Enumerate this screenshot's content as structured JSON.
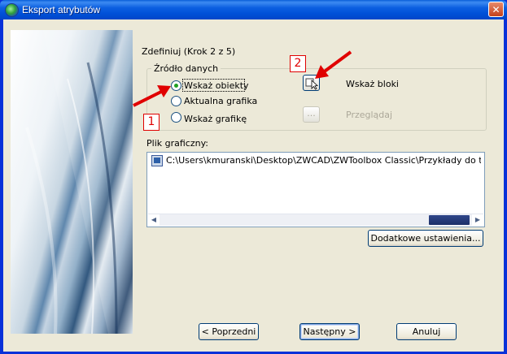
{
  "window": {
    "title": "Eksport atrybutów",
    "close_symbol": "✕"
  },
  "wizard": {
    "step_title": "Zdefiniuj (Krok 2 z 5)",
    "source_group": {
      "title": "Źródło danych",
      "options": [
        {
          "label": "Wskaż obiekty",
          "checked": true
        },
        {
          "label": "Aktualna grafika",
          "checked": false
        },
        {
          "label": "Wskaż grafikę",
          "checked": false
        }
      ],
      "pick_blocks_label": "Wskaż bloki",
      "browse_button_label": "...",
      "browse_label": "Przeglądaj"
    },
    "graphic_file": {
      "label": "Plik graficzny:",
      "items": [
        "C:\\Users\\kmuranski\\Desktop\\ZWCAD\\ZWToolbox Classic\\Przykłady do toolboxa"
      ]
    },
    "additional_settings_button": "Dodatkowe ustawienia...",
    "back_button": "< Poprzedni",
    "next_button": "Następny >",
    "cancel_button": "Anuluj"
  },
  "annotations": {
    "marker_1": "1",
    "marker_2": "2",
    "arrow_color": "#e00000"
  }
}
